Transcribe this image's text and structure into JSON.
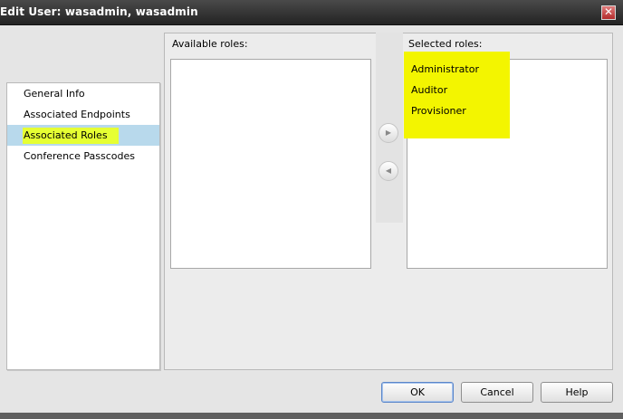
{
  "dialog": {
    "title": "Edit User: wasadmin, wasadmin",
    "close_glyph": "✕"
  },
  "nav": {
    "items": [
      {
        "label": "General Info",
        "selected": false
      },
      {
        "label": "Associated Endpoints",
        "selected": false
      },
      {
        "label": "Associated Roles",
        "selected": true
      },
      {
        "label": "Conference Passcodes",
        "selected": false
      }
    ]
  },
  "roles": {
    "available_label": "Available roles:",
    "selected_label": "Selected roles:",
    "available": [],
    "selected": [
      "Administrator",
      "Auditor",
      "Provisioner"
    ],
    "add_icon": "▶",
    "remove_icon": "◀"
  },
  "buttons": {
    "ok": "OK",
    "cancel": "Cancel",
    "help": "Help"
  },
  "colors": {
    "highlight": "#f3f500",
    "selection": "#b8d9ec",
    "titlebar": "#2e2e2e"
  }
}
